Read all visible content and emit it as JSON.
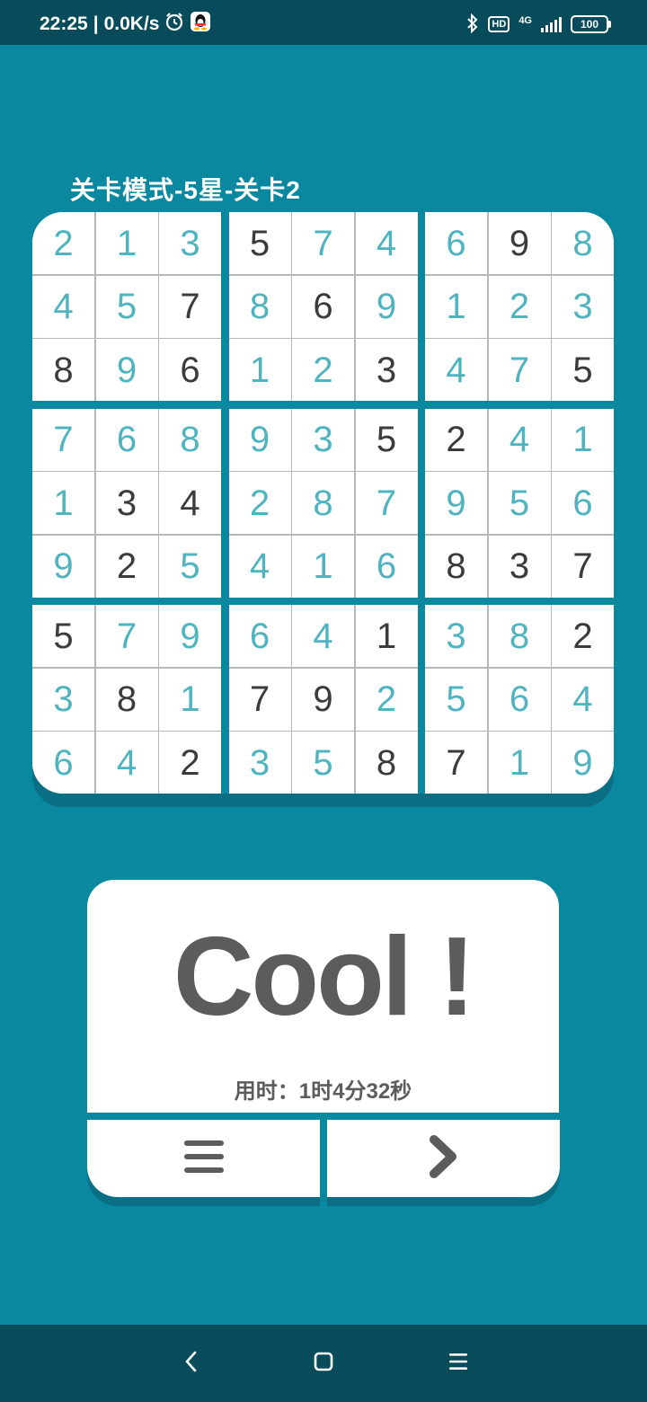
{
  "status_bar": {
    "time": "22:25",
    "separator": "|",
    "speed": "0.0K/s",
    "hd": "HD",
    "network": "4G",
    "battery": "100",
    "icons": [
      "alarm-icon",
      "qq-icon",
      "bluetooth-icon",
      "signal-icon",
      "battery-icon"
    ]
  },
  "level_title": "关卡模式-5星-关卡2",
  "board": {
    "rows": [
      [
        "2",
        "1",
        "3",
        "5",
        "7",
        "4",
        "6",
        "9",
        "8"
      ],
      [
        "4",
        "5",
        "7",
        "8",
        "6",
        "9",
        "1",
        "2",
        "3"
      ],
      [
        "8",
        "9",
        "6",
        "1",
        "2",
        "3",
        "4",
        "7",
        "5"
      ],
      [
        "7",
        "6",
        "8",
        "9",
        "3",
        "5",
        "2",
        "4",
        "1"
      ],
      [
        "1",
        "3",
        "4",
        "2",
        "8",
        "7",
        "9",
        "5",
        "6"
      ],
      [
        "9",
        "2",
        "5",
        "4",
        "1",
        "6",
        "8",
        "3",
        "7"
      ],
      [
        "5",
        "7",
        "9",
        "6",
        "4",
        "1",
        "3",
        "8",
        "2"
      ],
      [
        "3",
        "8",
        "1",
        "7",
        "9",
        "2",
        "5",
        "6",
        "4"
      ],
      [
        "6",
        "4",
        "2",
        "3",
        "5",
        "8",
        "7",
        "1",
        "9"
      ]
    ],
    "given": [
      [
        0,
        0,
        0,
        1,
        0,
        0,
        0,
        1,
        0
      ],
      [
        0,
        0,
        1,
        0,
        1,
        0,
        0,
        0,
        0
      ],
      [
        1,
        0,
        1,
        0,
        0,
        1,
        0,
        0,
        1
      ],
      [
        0,
        0,
        0,
        0,
        0,
        1,
        1,
        0,
        0
      ],
      [
        0,
        1,
        1,
        0,
        0,
        0,
        0,
        0,
        0
      ],
      [
        0,
        1,
        0,
        0,
        0,
        0,
        1,
        1,
        1
      ],
      [
        1,
        0,
        0,
        0,
        0,
        1,
        0,
        0,
        1
      ],
      [
        0,
        1,
        0,
        1,
        1,
        0,
        0,
        0,
        0
      ],
      [
        0,
        0,
        1,
        0,
        0,
        1,
        1,
        0,
        0
      ]
    ],
    "colors": {
      "given": "#3b3b3b",
      "user": "#4fb3c0"
    }
  },
  "result": {
    "message": "Cool !",
    "time_label": "用时：1时4分32秒"
  },
  "buttons": {
    "menu_icon": "menu-icon",
    "next_icon": "chevron-right-icon"
  },
  "nav_bar": {
    "icons": [
      "back-icon",
      "home-icon",
      "recents-icon"
    ]
  },
  "colors": {
    "background": "#0a88a0",
    "status_bar": "#084c5c",
    "card": "#ffffff",
    "text_dark": "#5c5c5c"
  }
}
